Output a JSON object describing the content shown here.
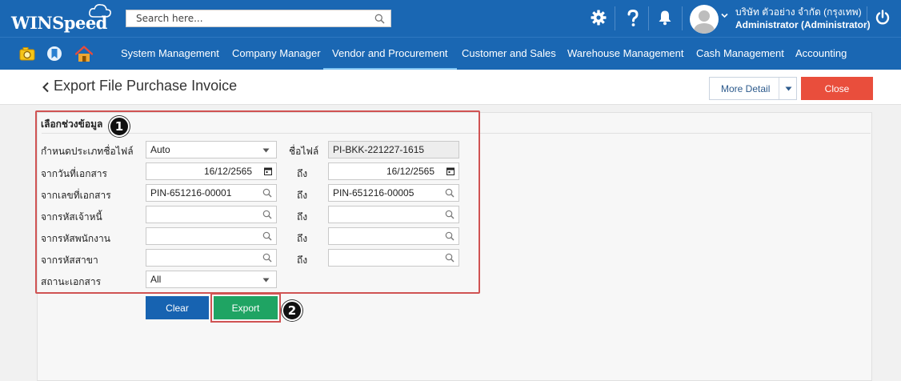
{
  "header": {
    "logo_text": "WINSpeed",
    "search_placeholder": "Search here...",
    "company": "บริษัท ตัวอย่าง จำกัด (กรุงเทพ)",
    "user": "Administrator (Administrator)"
  },
  "menu": {
    "items": [
      {
        "label": "System Management"
      },
      {
        "label": "Company Manager"
      },
      {
        "label": "Vendor and Procurement"
      },
      {
        "label": "Customer and Sales"
      },
      {
        "label": "Warehouse Management"
      },
      {
        "label": "Cash Management"
      },
      {
        "label": "Accounting"
      }
    ],
    "active": "Vendor and Procurement"
  },
  "page": {
    "title": "Export File Purchase Invoice",
    "more_detail_label": "More Detail",
    "close_label": "Close"
  },
  "form": {
    "section_title": "เลือกช่วงข้อมูล",
    "badge_1": "1",
    "badge_2": "2",
    "file_type_label": "กำหนดประเภทชื่อไฟล์",
    "file_type_value": "Auto",
    "file_name_label": "ชื่อไฟล์",
    "file_name_value": "PI-BKK-221227-1615",
    "date_from_label": "จากวันที่เอกสาร",
    "date_from_value": "16/12/2565",
    "date_to_value": "16/12/2565",
    "doc_from_label": "จากเลขที่เอกสาร",
    "doc_from_value": "PIN-651216-00001",
    "doc_to_value": "PIN-651216-00005",
    "creditor_label": "จากรหัสเจ้าหนี้",
    "employee_label": "จากรหัสพนักงาน",
    "branch_label": "จากรหัสสาขา",
    "to_label": "ถึง",
    "status_label": "สถานะเอกสาร",
    "status_value": "All",
    "clear_label": "Clear",
    "export_label": "Export"
  },
  "colors": {
    "header_blue": "#1a67b3",
    "close_red": "#e94e3c",
    "clear_blue": "#1763b1",
    "export_green": "#1fa463",
    "highlight_red": "#d05353"
  }
}
